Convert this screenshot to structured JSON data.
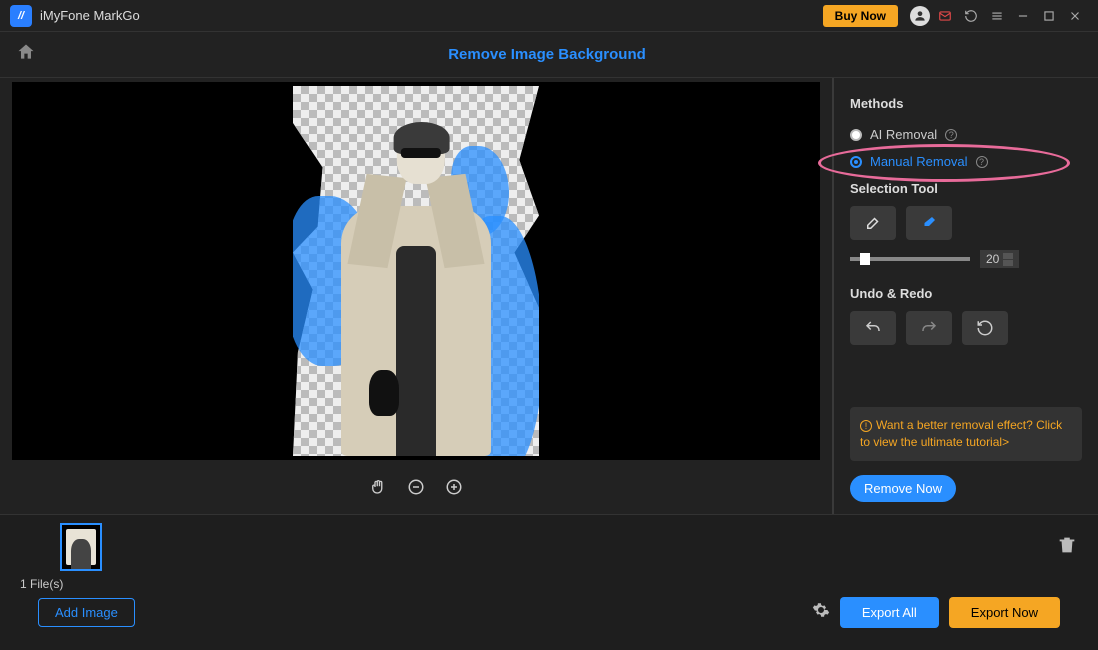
{
  "titlebar": {
    "app_name": "iMyFone MarkGo",
    "buy_label": "Buy Now"
  },
  "header": {
    "page_title": "Remove Image Background"
  },
  "sidebar": {
    "methods_title": "Methods",
    "method_ai": "AI Removal",
    "method_manual": "Manual Removal",
    "selection_title": "Selection Tool",
    "brush_size": "20",
    "undo_title": "Undo & Redo",
    "tip_text": "Want a better removal effect? Click to view the ultimate tutorial>",
    "remove_now": "Remove Now"
  },
  "footer": {
    "file_count": "1 File(s)",
    "add_image": "Add Image",
    "export_all": "Export All",
    "export_now": "Export Now"
  }
}
